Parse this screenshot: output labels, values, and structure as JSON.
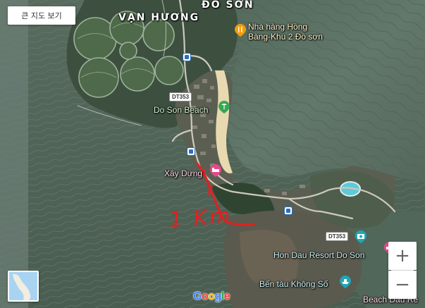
{
  "map": {
    "type": "satellite",
    "controls": {
      "view_larger_label": "큰 지도 보기",
      "zoom_in_label": "+",
      "zoom_out_label": "−"
    },
    "area_labels": [
      {
        "id": "van-huong",
        "text": "VẠN HƯƠNG"
      },
      {
        "id": "do-son-area",
        "text": "ĐỒ SƠN"
      }
    ],
    "places": [
      {
        "id": "restaurant",
        "text": "Nhà hàng Hồng",
        "text2": "Bàng-Khu 2 Đồ sơn",
        "icon": "restaurant-icon",
        "color": "#f29d0d"
      },
      {
        "id": "beach",
        "text": "Do Son Beach",
        "icon": "beach-icon",
        "color": "#34a853"
      },
      {
        "id": "hotel",
        "text": "Xây Dựng",
        "icon": "hotel-icon",
        "color": "#e8478b"
      },
      {
        "id": "resort",
        "text": "Hon Dau Resort Do Son",
        "icon": "camera-icon",
        "color": "#1ea8b3"
      },
      {
        "id": "ferry",
        "text": "Bến tàu Không Số",
        "icon": "ferry-icon",
        "color": "#1ea8b3"
      },
      {
        "id": "beach-dau",
        "text": "Beach Dau Re",
        "icon": "hotel-icon",
        "color": "#e8478b"
      }
    ],
    "road_labels": [
      "DT353",
      "DT353"
    ],
    "annotation": {
      "text": "1 Km",
      "color": "#e32020"
    },
    "attribution": {
      "letters": [
        "G",
        "o",
        "o",
        "g",
        "l",
        "e"
      ],
      "colors": [
        "#4285f4",
        "#ea4335",
        "#fbbc05",
        "#4285f4",
        "#34a853",
        "#ea4335"
      ]
    },
    "colors": {
      "water": "#5e7567",
      "land": "#384a37",
      "beach": "#e8d9b0",
      "road": "#cfc9bd",
      "annotation": "#e32020"
    }
  }
}
